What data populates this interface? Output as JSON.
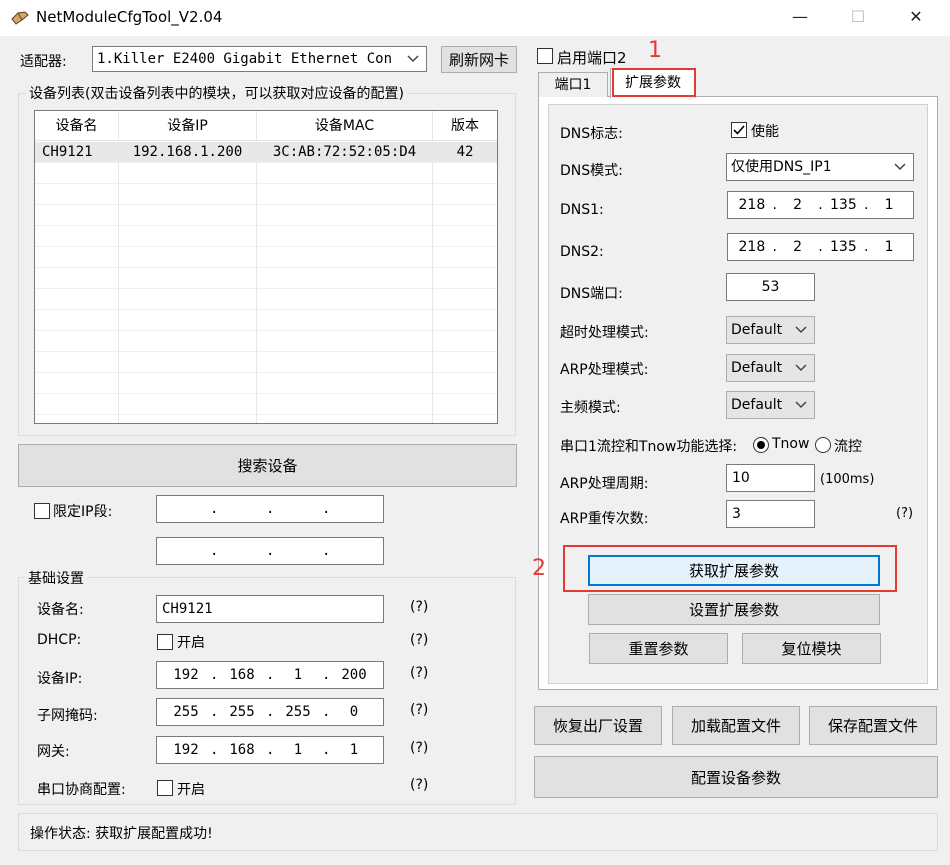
{
  "window": {
    "title": "NetModuleCfgTool_V2.04",
    "minimize_glyph": "—",
    "maximize_glyph": "☐",
    "close_glyph": "✕"
  },
  "adapter": {
    "label": "适配器:",
    "value": "1.Killer E2400 Gigabit Ethernet Con",
    "refresh_button": "刷新网卡"
  },
  "device_list": {
    "group_title": "设备列表(双击设备列表中的模块，可以获取对应设备的配置)",
    "columns": [
      "设备名",
      "设备IP",
      "设备MAC",
      "版本"
    ],
    "rows": [
      [
        "CH9121",
        "192.168.1.200",
        "3C:AB:72:52:05:D4",
        "42"
      ]
    ]
  },
  "search_button": "搜索设备",
  "ip_range": {
    "checkbox_label": "限定IP段:",
    "checked": false,
    "start": [
      "",
      "",
      "",
      ""
    ],
    "end": [
      "",
      "",
      "",
      ""
    ]
  },
  "basic": {
    "group_title": "基础设置",
    "device_name_label": "设备名:",
    "device_name_value": "CH9121",
    "dhcp_label": "DHCP:",
    "dhcp_checkbox_label": "开启",
    "device_ip_label": "设备IP:",
    "device_ip": [
      "192",
      "168",
      "1",
      "200"
    ],
    "subnet_label": "子网掩码:",
    "subnet": [
      "255",
      "255",
      "255",
      "0"
    ],
    "gateway_label": "网关:",
    "gateway": [
      "192",
      "168",
      "1",
      "1"
    ],
    "serial_neg_label": "串口协商配置:",
    "serial_neg_checkbox_label": "开启",
    "help": "(?)"
  },
  "status": {
    "text": "操作状态: 获取扩展配置成功!"
  },
  "port2": {
    "checkbox_label": "启用端口2",
    "checked": false
  },
  "tabs": [
    {
      "label": "端口1",
      "active": false
    },
    {
      "label": "扩展参数",
      "active": true
    }
  ],
  "annotations": {
    "num1": "1",
    "num2": "2"
  },
  "ext": {
    "dns_flag_label": "DNS标志:",
    "dns_flag_checkbox": "使能",
    "dns_flag_checked": true,
    "dns_mode_label": "DNS模式:",
    "dns_mode_value": "仅使用DNS_IP1",
    "dns1_label": "DNS1:",
    "dns1": [
      "218",
      "2",
      "135",
      "1"
    ],
    "dns2_label": "DNS2:",
    "dns2": [
      "218",
      "2",
      "135",
      "1"
    ],
    "dns_port_label": "DNS端口:",
    "dns_port_value": "53",
    "timeout_mode_label": "超时处理模式:",
    "timeout_mode_value": "Default",
    "arp_mode_label": "ARP处理模式:",
    "arp_mode_value": "Default",
    "freq_mode_label": "主频模式:",
    "freq_mode_value": "Default",
    "flow_label": "串口1流控和Tnow功能选择:",
    "flow_option1": "Tnow",
    "flow_option2": "流控",
    "flow_selected": "Tnow",
    "arp_period_label": "ARP处理周期:",
    "arp_period_value": "10",
    "arp_period_unit": "(100ms)",
    "arp_retry_label": "ARP重传次数:",
    "arp_retry_value": "3",
    "help": "(?)",
    "get_button": "获取扩展参数",
    "set_button": "设置扩展参数",
    "reset_params_button": "重置参数",
    "reset_module_button": "复位模块"
  },
  "bottom": {
    "factory_button": "恢复出厂设置",
    "load_button": "加载配置文件",
    "save_button": "保存配置文件",
    "config_button": "配置设备参数"
  },
  "colors": {
    "annotation": "#e53935",
    "focus": "#0078d7"
  }
}
